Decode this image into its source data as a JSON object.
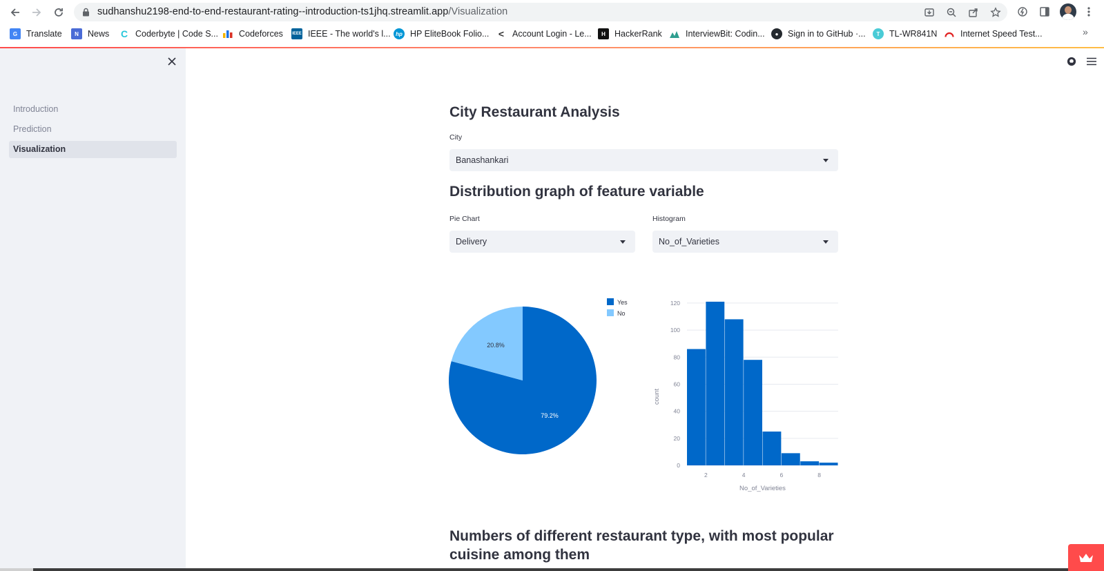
{
  "browser": {
    "url_host": "sudhanshu2198-end-to-end-restaurant-rating--introduction-ts1jhq.streamlit.app",
    "url_path": "/Visualization",
    "bookmarks": [
      {
        "label": "Translate",
        "icon": "google-translate-icon",
        "color": "#4285f4"
      },
      {
        "label": "News",
        "icon": "google-news-icon",
        "color": "#4a6bd6"
      },
      {
        "label": "Coderbyte | Code S...",
        "icon": "coderbyte-icon",
        "color": "#26c6da"
      },
      {
        "label": "Codeforces",
        "icon": "codeforces-icon",
        "color": "#f4b400"
      },
      {
        "label": "IEEE - The world's l...",
        "icon": "ieee-icon",
        "color": "#00629b"
      },
      {
        "label": "HP EliteBook Folio...",
        "icon": "hp-icon",
        "color": "#0096d6"
      },
      {
        "label": "Account Login - Le...",
        "icon": "lenovo-icon",
        "color": "#333333"
      },
      {
        "label": "HackerRank",
        "icon": "hackerrank-icon",
        "color": "#111111"
      },
      {
        "label": "InterviewBit: Codin...",
        "icon": "interviewbit-icon",
        "color": "#2f9e8f"
      },
      {
        "label": "Sign in to GitHub ·...",
        "icon": "github-icon",
        "color": "#24292e"
      },
      {
        "label": "TL-WR841N",
        "icon": "tplink-icon",
        "color": "#4acbd6"
      },
      {
        "label": "Internet Speed Test...",
        "icon": "speedtest-icon",
        "color": "#e02020"
      }
    ],
    "more_label": "»"
  },
  "sidebar": {
    "items": [
      {
        "label": "Introduction",
        "active": false
      },
      {
        "label": "Prediction",
        "active": false
      },
      {
        "label": "Visualization",
        "active": true
      }
    ]
  },
  "main": {
    "title": "City Restaurant Analysis",
    "city_label": "City",
    "city_value": "Banashankari",
    "dist_title": "Distribution graph of feature variable",
    "pie_label": "Pie Chart",
    "pie_value": "Delivery",
    "hist_label": "Histogram",
    "hist_value": "No_of_Varieties",
    "bottom_title": "Numbers of different restaurant type, with most popular cuisine among them"
  },
  "colors": {
    "accent": "#ff4b4b",
    "series_dark": "#0068c9",
    "series_light": "#83c9ff"
  },
  "chart_data": [
    {
      "type": "pie",
      "labels": [
        "Yes",
        "No"
      ],
      "values": [
        79.2,
        20.8
      ],
      "value_labels": [
        "79.2%",
        "20.8%"
      ],
      "colors": [
        "#0068c9",
        "#83c9ff"
      ],
      "legend": "top-right"
    },
    {
      "type": "bar",
      "subtype": "histogram",
      "xlabel": "No_of_Varieties",
      "ylabel": "count",
      "bins": [
        [
          1,
          2
        ],
        [
          2,
          3
        ],
        [
          3,
          4
        ],
        [
          4,
          5
        ],
        [
          5,
          6
        ],
        [
          6,
          7
        ],
        [
          7,
          8
        ],
        [
          8,
          9
        ]
      ],
      "values": [
        86,
        121,
        108,
        78,
        25,
        9,
        3,
        2
      ],
      "xlim": [
        1,
        9
      ],
      "ylim": [
        0,
        122
      ],
      "xticks": [
        2,
        4,
        6,
        8
      ],
      "yticks": [
        0,
        20,
        40,
        60,
        80,
        100,
        120
      ],
      "grid": true,
      "color": "#0068c9"
    }
  ]
}
